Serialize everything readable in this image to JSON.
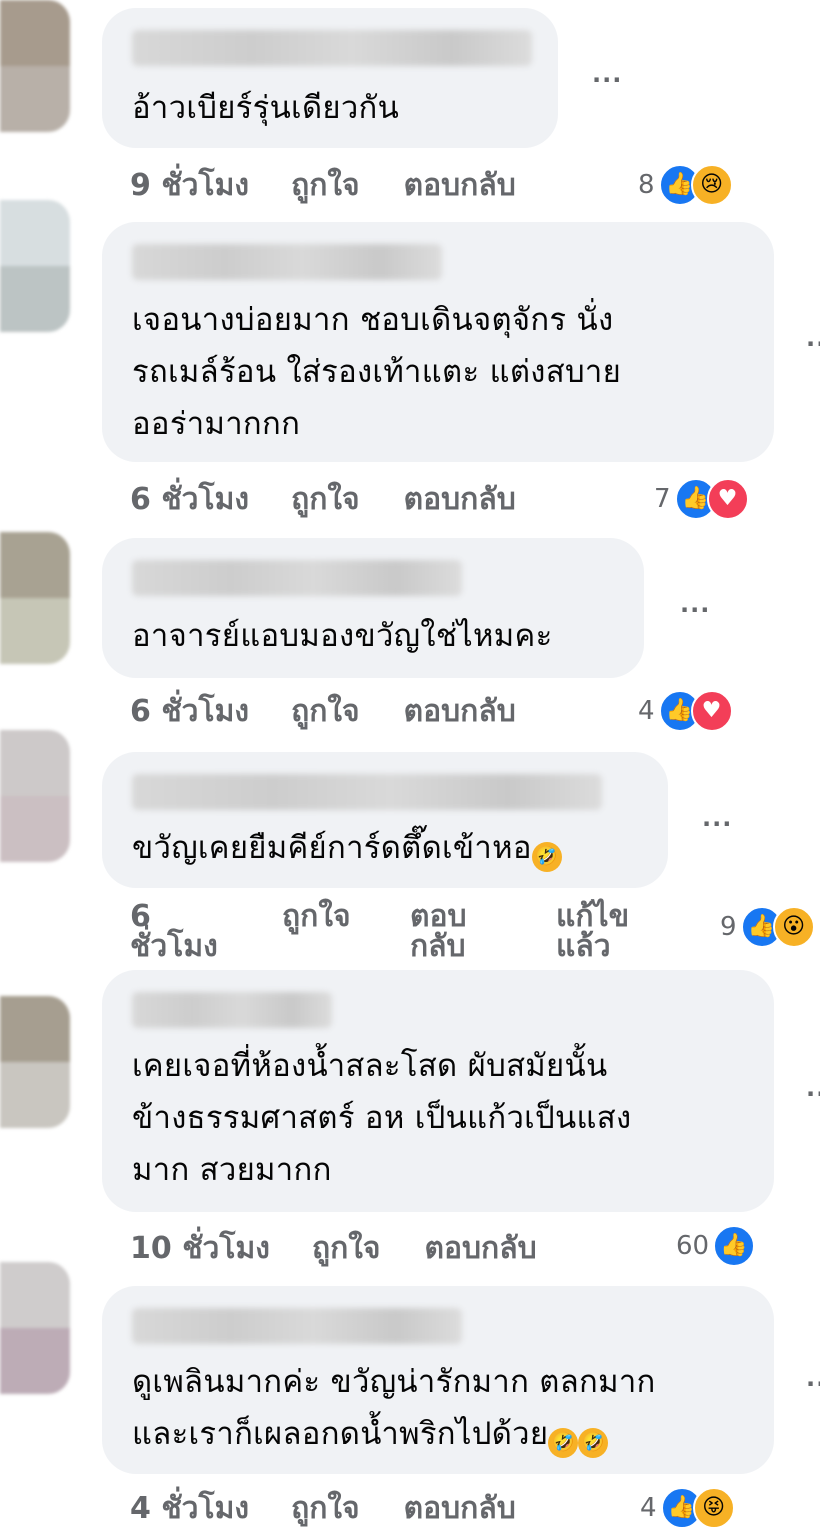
{
  "comments": [
    {
      "text_lines": [
        "อ้าวเบียร์รุ่นเดียวกัน"
      ],
      "time": "9 ชั่วโมง",
      "like": "ถูกใจ",
      "reply": "ตอบกลับ",
      "count": "8",
      "reactions": [
        "like-icon",
        "sad-icon"
      ],
      "avatar_colors": [
        "#a79b8d",
        "#b8b0a8"
      ]
    },
    {
      "text_lines": [
        "เจอนางบ่อยมาก ชอบเดินจตุจักร นั่ง",
        "รถเมล์ร้อน ใส่รองเท้าแตะ แต่งสบาย",
        "ออร่ามากกก"
      ],
      "time": "6 ชั่วโมง",
      "like": "ถูกใจ",
      "reply": "ตอบกลับ",
      "count": "7",
      "reactions": [
        "like-icon",
        "love-icon"
      ],
      "avatar_colors": [
        "#d7dee0",
        "#bcc4c4"
      ]
    },
    {
      "text_lines": [
        "อาจารย์แอบมองขวัญใช่ไหมคะ"
      ],
      "time": "6 ชั่วโมง",
      "like": "ถูกใจ",
      "reply": "ตอบกลับ",
      "count": "4",
      "reactions": [
        "like-icon",
        "love-icon"
      ],
      "avatar_colors": [
        "#a8a292",
        "#c6c6b6"
      ]
    },
    {
      "text_lines": [
        "ขวัญเคยยืมคีย์การ์ดตึ๊ดเข้าหอ"
      ],
      "time_line1": "6",
      "time_line2": "ชั่วโมง",
      "like": "ถูกใจ",
      "reply_line1": "ตอบ",
      "reply_line2": "กลับ",
      "edited_line1": "แก้ไข",
      "edited_line2": "แล้ว",
      "count": "9",
      "reactions": [
        "like-icon",
        "wow-icon"
      ],
      "avatar_colors": [
        "#cdc9c9",
        "#cbbfc2"
      ]
    },
    {
      "text_lines": [
        "เคยเจอที่ห้องน้ำสละโสด ผับสมัยนั้น",
        "ข้างธรรมศาสตร์ อห เป็นแก้วเป็นแสง",
        "มาก สวยมากก"
      ],
      "time": "10 ชั่วโมง",
      "like": "ถูกใจ",
      "reply": "ตอบกลับ",
      "count": "60",
      "reactions": [
        "like-icon"
      ],
      "avatar_colors": [
        "#a69e90",
        "#c9c6c0"
      ]
    },
    {
      "text_lines": [
        "ดูเพลินมากค่ะ ขวัญน่ารักมาก ตลกมาก",
        "และเราก็เผลอกดน้ำพริกไปด้วย"
      ],
      "time": "4 ชั่วโมง",
      "like": "ถูกใจ",
      "reply": "ตอบกลับ",
      "count": "4",
      "reactions": [
        "like-icon",
        "haha-icon"
      ],
      "avatar_colors": [
        "#cfcccc",
        "#bdacb6"
      ]
    }
  ],
  "more_label": "···"
}
